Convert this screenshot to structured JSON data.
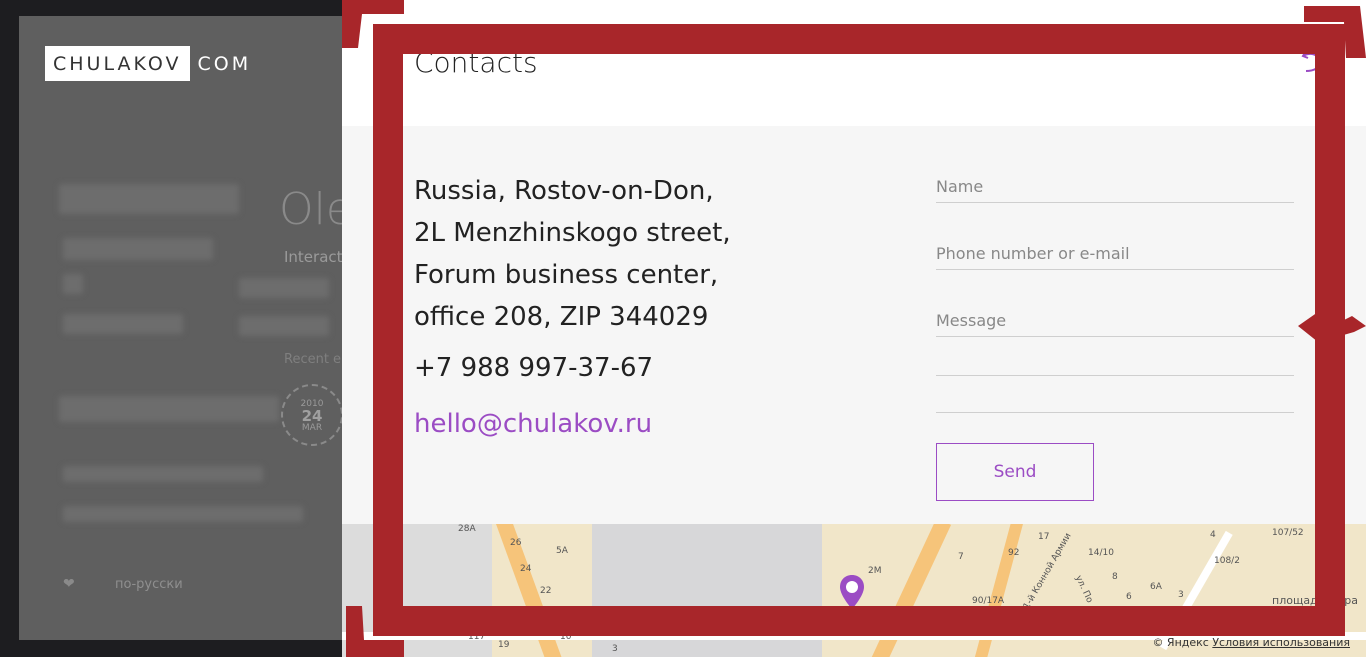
{
  "background": {
    "logo_main": "CHULAKOV",
    "logo_suffix": "COM",
    "name_partial": "Ole",
    "subtitle_partial": "Interact",
    "recent_partial": "Recent e",
    "badge_year": "2010",
    "badge_day": "24",
    "badge_month": "MAR",
    "lang_link": "по-русски"
  },
  "panel": {
    "title": "Contacts",
    "address_lines": [
      "Russia, Rostov-on-Don,",
      "2L Menzhinskogo street,",
      "Forum business center,",
      "office 208, ZIP 344029"
    ],
    "phone": "+7 988 997-37-67",
    "email": "hello@chulakov.ru"
  },
  "form": {
    "name_placeholder": "Name",
    "contact_placeholder": "Phone number or e-mail",
    "message_placeholder": "Message",
    "send_label": "Send"
  },
  "map": {
    "copyright": "© Яндекс",
    "terms": "Условия использования",
    "labels": [
      "28A",
      "26",
      "24",
      "22",
      "5A",
      "2М",
      "7",
      "92",
      "17",
      "14/10",
      "107/52",
      "4",
      "108/2",
      "90/17А",
      "8",
      "6А",
      "6",
      "3",
      "117",
      "19",
      "10",
      "3",
      "5",
      "2",
      "1-й Конной Армии",
      "ул. По",
      "площадь Мира"
    ]
  },
  "colors": {
    "accent": "#9b4cc4",
    "frame": "#a8262a"
  }
}
